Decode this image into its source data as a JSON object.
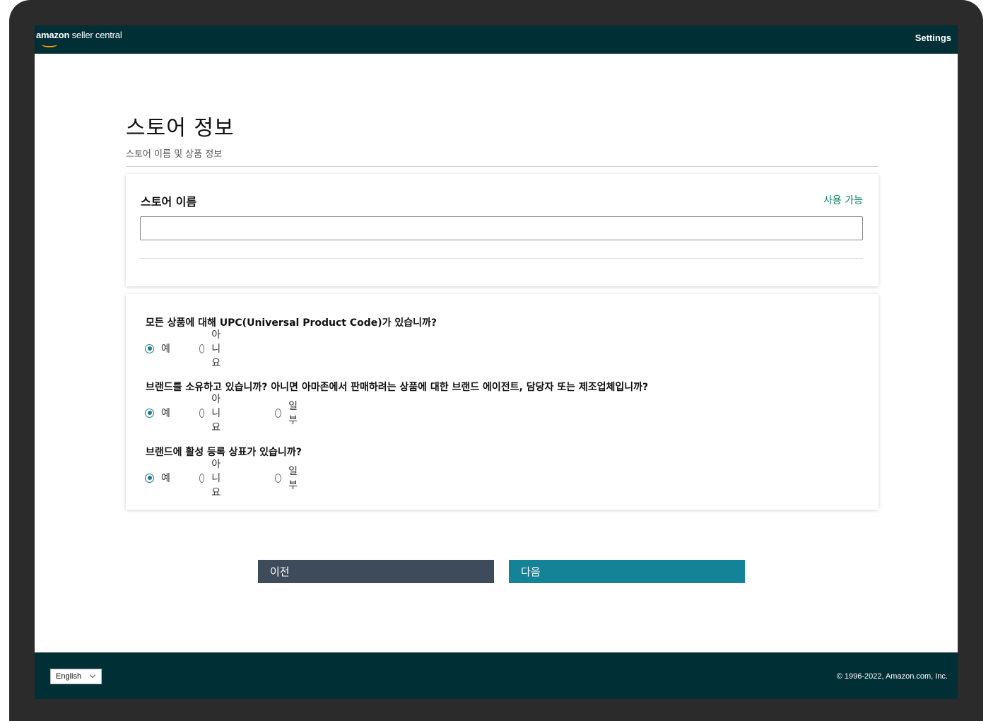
{
  "header": {
    "logo_brand": "amazon",
    "logo_rest": " seller central",
    "settings_label": "Settings"
  },
  "page": {
    "title": "스토어 정보",
    "subtitle": "스토어 이름 및 상품 정보"
  },
  "store_card": {
    "label": "스토어 이름",
    "availability": "사용 가능",
    "input_value": "",
    "input_placeholder": ""
  },
  "questions": [
    {
      "text": "모든 상품에 대해 UPC(Universal Product Code)가 있습니까?",
      "options": [
        "예",
        "아니요"
      ],
      "selected": "예"
    },
    {
      "text": "브랜드를 소유하고 있습니까? 아니면 아마존에서 판매하려는 상품에 대한 브랜드 에이전트, 담당자 또는 제조업체입니까?",
      "options": [
        "예",
        "아니요",
        "일부"
      ],
      "selected": "예"
    },
    {
      "text": "브랜드에 활성 등록 상표가 있습니까?",
      "options": [
        "예",
        "아니요",
        "일부"
      ],
      "selected": "예"
    }
  ],
  "buttons": {
    "prev_label": "이전",
    "next_label": "다음"
  },
  "footer": {
    "language": "English",
    "copyright": "© 1996-2022, Amazon.com, Inc."
  },
  "colors": {
    "header_bg": "#002f36",
    "accent": "#1b7a8f",
    "available_text": "#067d62",
    "prev_button": "#3e4b5a",
    "next_button": "#148397"
  },
  "icons": {
    "language_dropdown": "chevron-down-icon",
    "logo_mark": "smile-arrow-icon"
  }
}
